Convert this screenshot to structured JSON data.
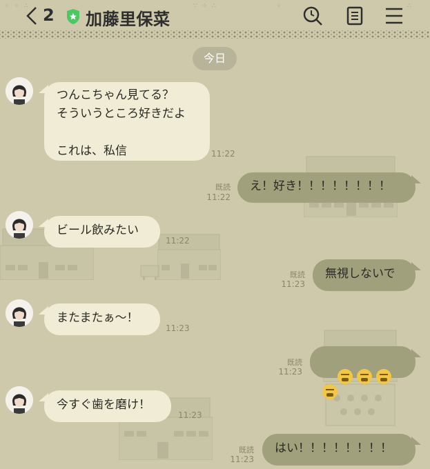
{
  "header": {
    "back_count": "2",
    "title": "加藤里保菜",
    "colors": {
      "shield": "#4cc764",
      "text": "#2e2e2e"
    }
  },
  "date_chip": "今日",
  "messages": [
    {
      "side": "in",
      "text": "つんこちゃん見てる？\nそういうところ好きだよ\n\nこれは、私信",
      "time": "11:22"
    },
    {
      "side": "out",
      "text": "え！好き！！！！！！！！",
      "time": "11:22",
      "read": "既読"
    },
    {
      "side": "in",
      "text": "ビール飲みたい",
      "time": "11:22"
    },
    {
      "side": "out",
      "text": "無視しないで",
      "time": "11:23",
      "read": "既読"
    },
    {
      "side": "in",
      "text": "またまたぁ〜！",
      "time": "11:23"
    },
    {
      "side": "out",
      "text": "",
      "emoji": [
        "tired-face",
        "tired-face",
        "tired-face",
        "tired-face"
      ],
      "time": "11:23",
      "read": "既読"
    },
    {
      "side": "in",
      "text": "今すぐ歯を磨け！",
      "time": "11:23"
    },
    {
      "side": "out",
      "text": "はい！！！！！！！！",
      "time": "11:23",
      "read": "既読"
    }
  ]
}
